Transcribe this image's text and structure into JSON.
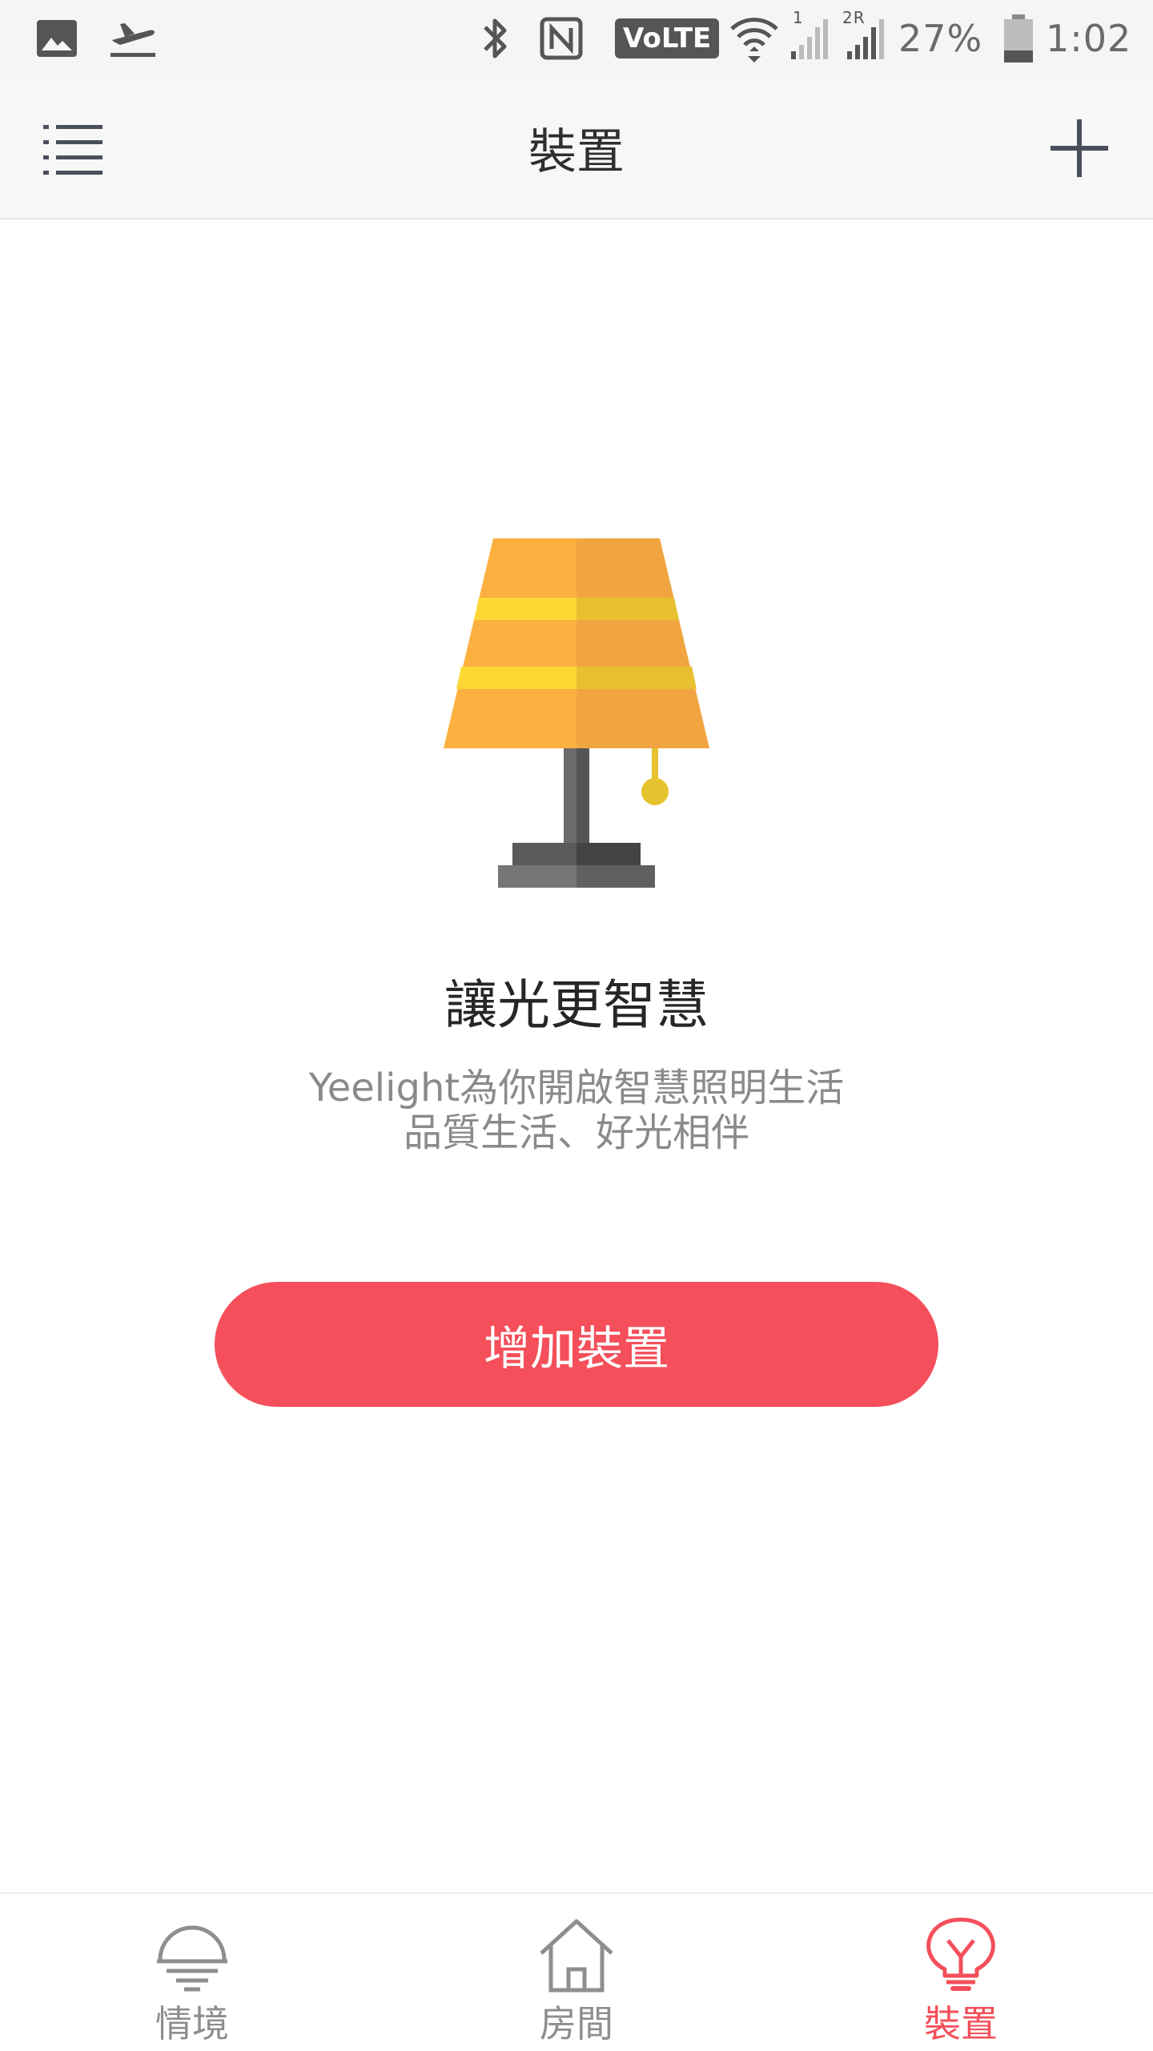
{
  "status_bar": {
    "network_badge": "VoLTE",
    "sim1_label": "1",
    "sim2_label": "2R",
    "battery_percent": "27%",
    "time": "1:02",
    "battery_level": 0.27,
    "icons": [
      "gallery-icon",
      "flight-icon",
      "bluetooth-icon",
      "nfc-icon",
      "wifi-icon",
      "signal-icon",
      "battery-icon"
    ]
  },
  "header": {
    "title": "裝置",
    "left_icon": "menu-icon",
    "right_icon": "plus-icon"
  },
  "empty_state": {
    "illustration": "table-lamp",
    "title": "讓光更智慧",
    "description_line1": "Yeelight為你開啟智慧照明生活",
    "description_line2": "品質生活、好光相伴",
    "button_label": "增加裝置"
  },
  "bottom_nav": {
    "tabs": [
      {
        "label": "情境",
        "icon": "scene-sunrise-icon",
        "active": false
      },
      {
        "label": "房間",
        "icon": "house-icon",
        "active": false
      },
      {
        "label": "裝置",
        "icon": "bulb-icon",
        "active": true
      }
    ]
  },
  "colors": {
    "accent": "#f44f5a",
    "inactive": "#8e8e8e",
    "lamp_shade": "#fbb040",
    "lamp_stripe": "#fdd835",
    "lamp_base": "#6b6b6b"
  }
}
